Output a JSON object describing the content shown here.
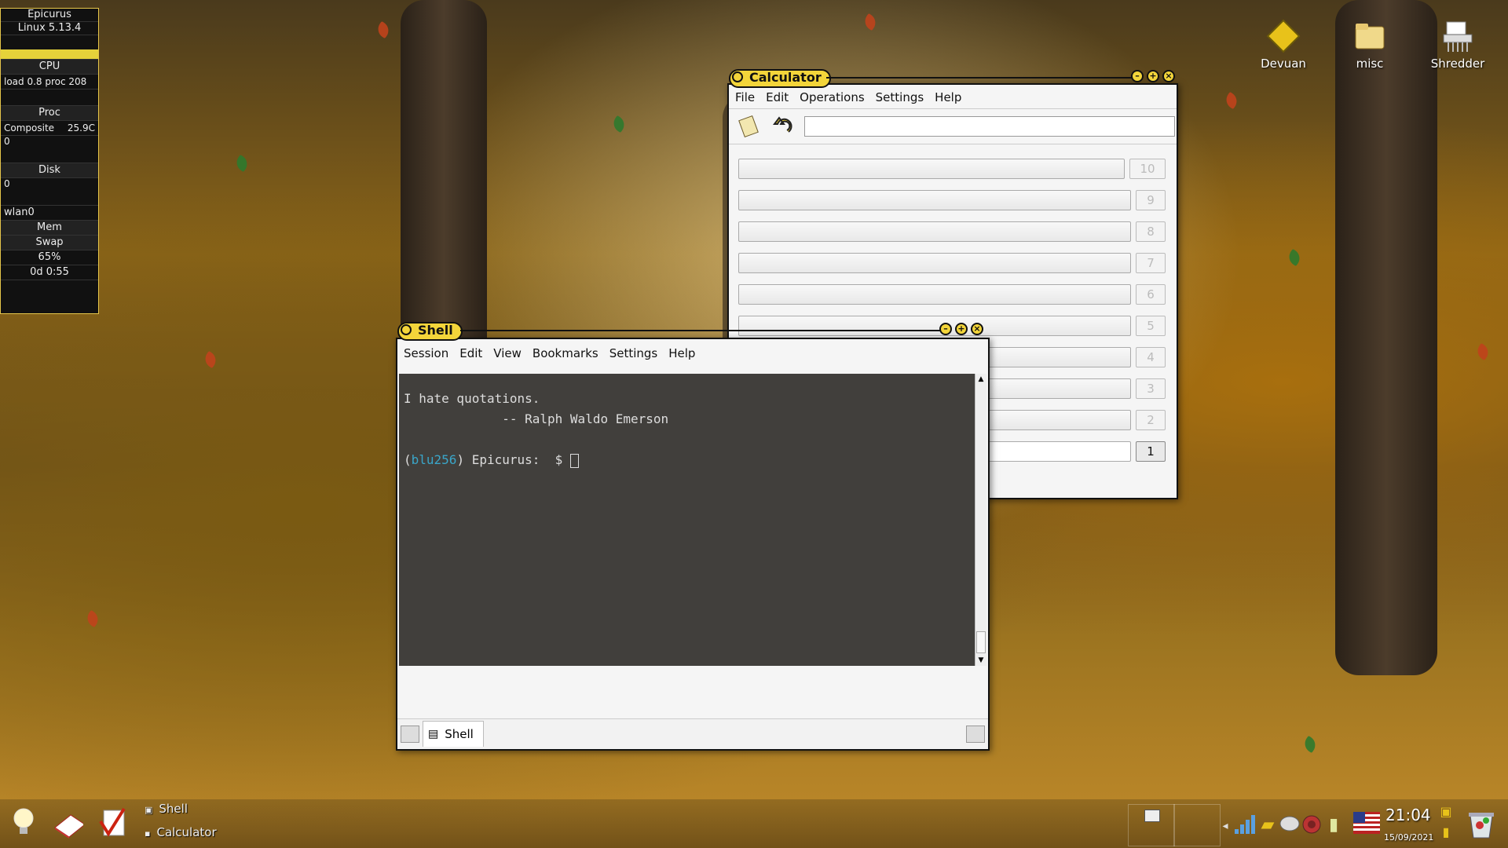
{
  "conky": {
    "host": "Epicurus",
    "kernel": "Linux 5.13.4",
    "cpu_label": "CPU",
    "load_text": "load 0.8 proc 208",
    "proc_label": "Proc",
    "composite_label": "Composite",
    "temp": "25.9C",
    "graph_zero_1": "0",
    "disk_label": "Disk",
    "graph_zero_2": "0",
    "net_label": "wlan0",
    "mem_label": "Mem",
    "swap_label": "Swap",
    "battery_percent": "65%",
    "uptime": "0d  0:55"
  },
  "desktop_icons": [
    {
      "label": "Devuan",
      "icon": "devuan-diamond-icon"
    },
    {
      "label": "misc",
      "icon": "folder-icon"
    },
    {
      "label": "Shredder",
      "icon": "shredder-icon"
    }
  ],
  "calculator": {
    "title": "Calculator",
    "menu": [
      "File",
      "Edit",
      "Operations",
      "Settings",
      "Help"
    ],
    "input_value": "",
    "stack_labels": [
      "10",
      "9",
      "8",
      "7",
      "6",
      "5",
      "4",
      "3",
      "2",
      "1"
    ]
  },
  "shell": {
    "title": "Shell",
    "menu": [
      "Session",
      "Edit",
      "View",
      "Bookmarks",
      "Settings",
      "Help"
    ],
    "quote": "I hate quotations.",
    "author": "             -- Ralph Waldo Emerson",
    "prompt_open": "(",
    "prompt_env": "blu256",
    "prompt_rest": ") Epicurus:  $ ",
    "tab_label": "Shell"
  },
  "taskbar": {
    "tasks": [
      "Shell",
      "Calculator"
    ],
    "clock": "21:04",
    "date": "15/09/2021"
  },
  "colors": {
    "accent": "#f3d53a",
    "prompt_env": "#3aa6c9"
  }
}
